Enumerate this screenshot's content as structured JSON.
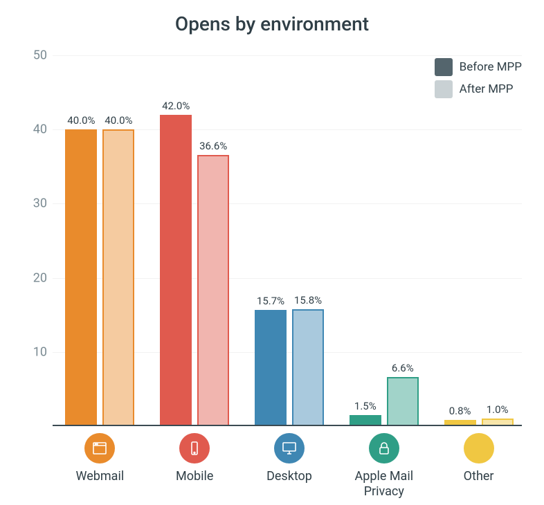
{
  "chart_data": {
    "type": "bar",
    "title": "Opens by environment",
    "ylabel": "",
    "xlabel": "",
    "ylim": [
      0,
      50
    ],
    "yticks": [
      10,
      20,
      30,
      40,
      50
    ],
    "categories": [
      "Webmail",
      "Mobile",
      "Desktop",
      "Apple Mail\nPrivacy",
      "Other"
    ],
    "series": [
      {
        "name": "Before MPP",
        "values": [
          40.0,
          42.0,
          15.7,
          1.5,
          0.8
        ]
      },
      {
        "name": "After MPP",
        "values": [
          40.0,
          36.6,
          15.8,
          6.6,
          1.0
        ]
      }
    ],
    "category_colors": [
      "#e98b2c",
      "#e05a4e",
      "#3f87b3",
      "#2f9e86",
      "#f0c742"
    ],
    "legend_swatches": [
      "#54656d",
      "#c9d1d4"
    ]
  },
  "value_labels": {
    "s0": [
      "40.0%",
      "42.0%",
      "15.7%",
      "1.5%",
      "0.8%"
    ],
    "s1": [
      "40.0%",
      "36.6%",
      "15.8%",
      "6.6%",
      "1.0%"
    ]
  },
  "icons": [
    "webmail",
    "mobile",
    "desktop",
    "lock",
    "none"
  ]
}
